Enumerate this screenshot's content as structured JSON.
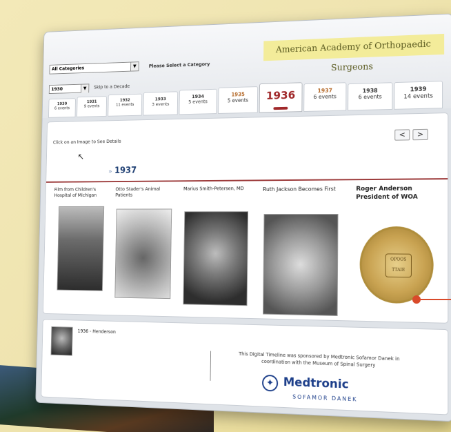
{
  "header": {
    "category_select": "All Categories",
    "please_select": "Please Select a Category",
    "org_title": "American Academy of Orthopaedic Surgeons",
    "decade_select": "1930",
    "skip_label": "Skip to a Decade"
  },
  "years": [
    {
      "year": "1930",
      "events": "6 events"
    },
    {
      "year": "1931",
      "events": "9 events"
    },
    {
      "year": "1932",
      "events": "11 events"
    },
    {
      "year": "1933",
      "events": "3 events"
    },
    {
      "year": "1934",
      "events": "5 events"
    },
    {
      "year": "1935",
      "events": "5 events"
    },
    {
      "year": "1936",
      "events": ""
    },
    {
      "year": "1937",
      "events": "6 events"
    },
    {
      "year": "1938",
      "events": "6 events"
    },
    {
      "year": "1939",
      "events": "14 events"
    }
  ],
  "main": {
    "hint": "Click on an Image to See Details",
    "year_heading": "1937",
    "prev_label": "<",
    "next_label": ">",
    "events": [
      {
        "title": "Film from Children's Hospital of Michigan"
      },
      {
        "title": "Otto Stader's Animal Patients"
      },
      {
        "title": "Marius Smith-Petersen, MD"
      },
      {
        "title": "Ruth Jackson Becomes First"
      },
      {
        "title": "Roger Anderson President of WOA"
      }
    ],
    "seal_text": "OPOOS TTAIE"
  },
  "footer": {
    "thumb_label": "1936 - Henderson",
    "sponsor_text": "This Digital Timeline was sponsored by Medtronic Sofamor Danek in coordination with the Museum of Spinal Surgery",
    "brand": "Medtronic",
    "brand_sub": "SOFAMOR DANEK"
  },
  "colors": {
    "accent_red": "#a0282a",
    "heading_blue": "#1e3f73",
    "medtronic_blue": "#1d3f8a",
    "title_bg": "#f3ec9a"
  }
}
